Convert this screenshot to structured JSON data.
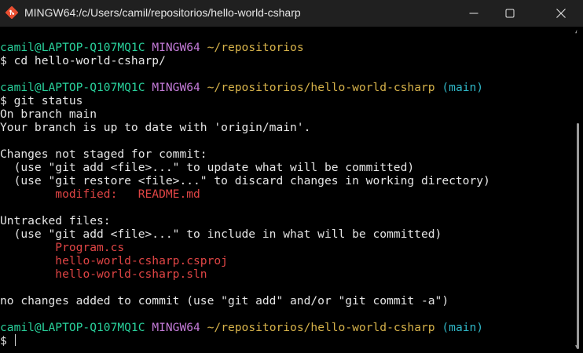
{
  "window": {
    "title": "MINGW64:/c/Users/camil/repositorios/hello-world-csharp"
  },
  "colors": {
    "user_host": "#29d19b",
    "msystem": "#c47bd8",
    "path": "#d6b24a",
    "branch": "#2fb6c6",
    "file": "#e04545"
  },
  "terminal": {
    "prompt1": {
      "user_host": "camil@LAPTOP-Q107MQ1C",
      "msystem": "MINGW64",
      "path": "~/repositorios"
    },
    "cmd1": "$ cd hello-world-csharp/",
    "prompt2": {
      "user_host": "camil@LAPTOP-Q107MQ1C",
      "msystem": "MINGW64",
      "path": "~/repositorios/hello-world-csharp",
      "branch": "(main)"
    },
    "cmd2": "$ git status",
    "output": {
      "on_branch": "On branch main",
      "up_to_date": "Your branch is up to date with 'origin/main'.",
      "changes_header": "Changes not staged for commit:",
      "hint_add": "  (use \"git add <file>...\" to update what will be committed)",
      "hint_restore": "  (use \"git restore <file>...\" to discard changes in working directory)",
      "modified_label": "        modified:   ",
      "modified_file": "README.md",
      "untracked_header": "Untracked files:",
      "hint_untracked": "  (use \"git add <file>...\" to include in what will be committed)",
      "untracked_indent": "        ",
      "untracked_files": [
        "Program.cs",
        "hello-world-csharp.csproj",
        "hello-world-csharp.sln"
      ],
      "summary": "no changes added to commit (use \"git add\" and/or \"git commit -a\")"
    },
    "prompt3": {
      "user_host": "camil@LAPTOP-Q107MQ1C",
      "msystem": "MINGW64",
      "path": "~/repositorios/hello-world-csharp",
      "branch": "(main)"
    },
    "cmd3": "$ "
  }
}
